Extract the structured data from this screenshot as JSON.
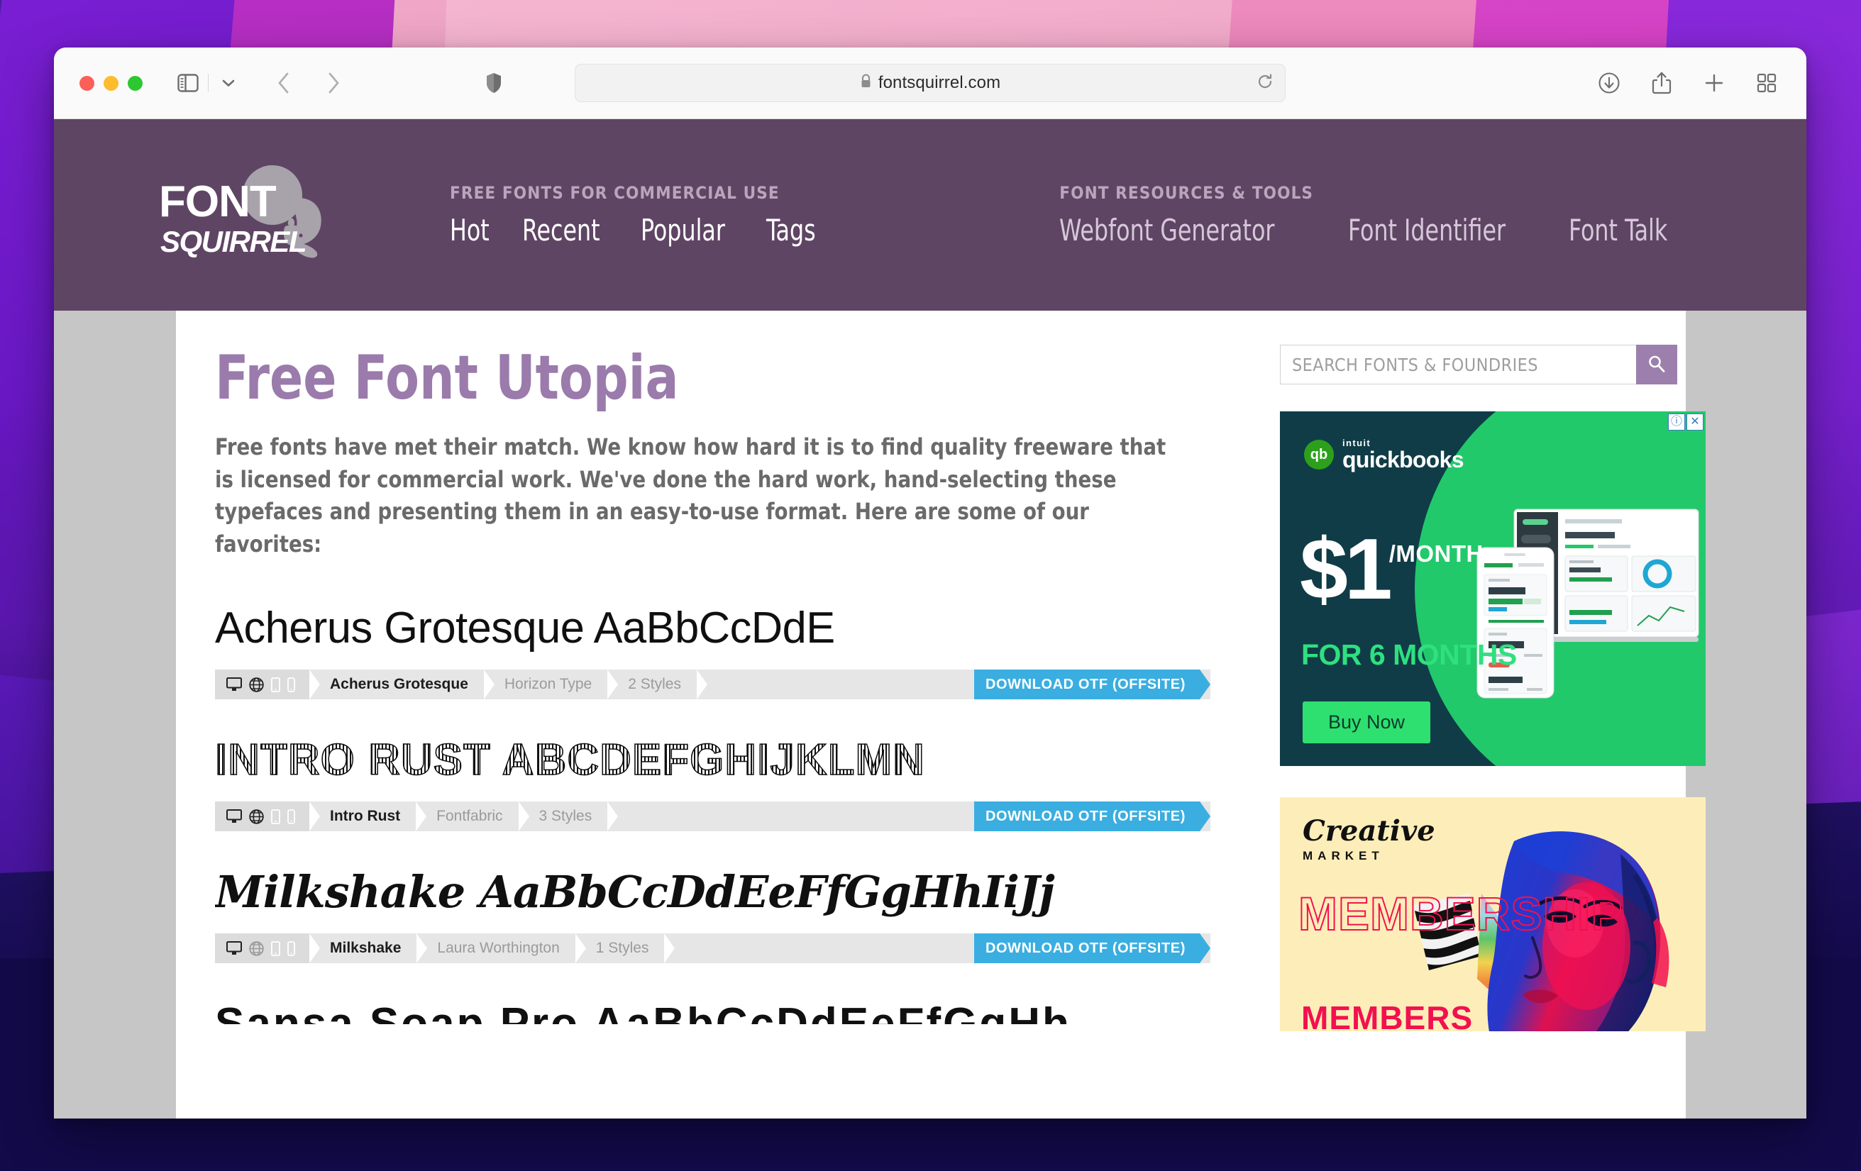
{
  "browser": {
    "url": "fontsquirrel.com",
    "lock_icon": "lock-icon",
    "shield_icon": "shield-icon",
    "sidebar_icon": "sidebar-toggle-icon",
    "chevron_icon": "chevron-down-icon",
    "back_icon": "back-arrow-icon",
    "forward_icon": "forward-arrow-icon",
    "reload_icon": "reload-icon",
    "downloads_icon": "downloads-icon",
    "share_icon": "share-icon",
    "new_tab_icon": "plus-icon",
    "tab_overview_icon": "tab-overview-icon"
  },
  "site": {
    "logo_primary": "FONT",
    "logo_secondary": "SQUIRREL",
    "nav_groups": [
      {
        "kicker": "FREE FONTS FOR COMMERCIAL USE",
        "links": [
          "Hot",
          "Recent",
          "Popular",
          "Tags"
        ]
      },
      {
        "kicker": "FONT RESOURCES & TOOLS",
        "links": [
          "Webfont Generator",
          "Font Identifier",
          "Font Talk"
        ]
      }
    ]
  },
  "main": {
    "title": "Free Font Utopia",
    "intro": "Free fonts have met their match. We know how hard it is to find quality freeware that is licensed for commercial work. We've done the hard work, hand-selecting these typefaces and presenting them in an easy-to-use format. Here are some of our favorites:",
    "fonts": [
      {
        "specimen": "Acherus Grotesque AaBbCcDdE",
        "name": "Acherus Grotesque",
        "foundry": "Horizon Type",
        "styles": "2 Styles",
        "download_label": "DOWNLOAD OTF (OFFSITE)",
        "icons": [
          "desktop-icon",
          "web-icon",
          "mobile-icon",
          "tablet-icon"
        ],
        "web_enabled": true
      },
      {
        "specimen": "INTRO RUST ABCDEFGHIJKLMN",
        "name": "Intro Rust",
        "foundry": "Fontfabric",
        "styles": "3 Styles",
        "download_label": "DOWNLOAD OTF (OFFSITE)",
        "icons": [
          "desktop-icon",
          "web-icon",
          "mobile-icon",
          "tablet-icon"
        ],
        "web_enabled": true
      },
      {
        "specimen": "Milkshake AaBbCcDdEeFfGgHhIiJj",
        "name": "Milkshake",
        "foundry": "Laura Worthington",
        "styles": "1 Styles",
        "download_label": "DOWNLOAD OTF (OFFSITE)",
        "icons": [
          "desktop-icon",
          "web-icon",
          "mobile-icon",
          "tablet-icon"
        ],
        "web_enabled": false
      }
    ],
    "partial_specimen": "Sansa Soap Pro AaBbCcDdEeFfGgHh"
  },
  "sidebar": {
    "search_placeholder": "SEARCH FONTS & FOUNDRIES",
    "search_value": "",
    "search_icon": "search-icon",
    "ads": [
      {
        "id": "quickbooks",
        "brand_small": "intuit",
        "brand": "quickbooks",
        "brand_mark": "qb",
        "price": "$1",
        "price_unit": "/MONTH",
        "subhead": "FOR 6 MONTHS",
        "cta": "Buy Now",
        "info_badge": "ⓘ",
        "close_badge": "✕",
        "bg_color": "#103c47",
        "accent_color": "#21c96b"
      },
      {
        "id": "creative-market",
        "brand": "Creative",
        "brand_sub": "MARKET",
        "headline": "MEMBERSHIP",
        "subline": "MEMBERS",
        "bg_color": "#fdeeb9",
        "accent_color": "#f2114f"
      }
    ]
  },
  "colors": {
    "header_purple": "#5f4564",
    "title_purple": "#9a7bab",
    "download_blue": "#3aaee0",
    "search_button_purple": "#9d7fae",
    "page_bg_gray": "#c6c6c6"
  }
}
